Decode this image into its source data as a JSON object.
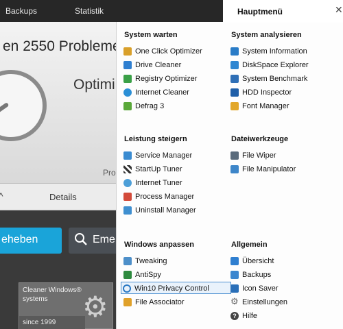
{
  "topbar": {
    "tab_backups": "Backups",
    "tab_statistik": "Statistik"
  },
  "background": {
    "problem_title": "en 2550 Probleme",
    "optimize_title": "Optimi",
    "pro_text": "Pro",
    "details_label": "Details",
    "fix_button_label": "eheben",
    "more_button_label": "Eme",
    "badge": {
      "line1": "Cleaner Windows®",
      "line2": "systems",
      "year": "since 1999"
    }
  },
  "menu": {
    "tab_label": "Hauptmenü",
    "sections": {
      "system_warten": {
        "title": "System warten",
        "items": [
          {
            "label": "One Click Optimizer",
            "icon": "one-click-optimizer-icon",
            "color": "#d9a02b"
          },
          {
            "label": "Drive Cleaner",
            "icon": "drive-cleaner-icon",
            "color": "#2f7fd0"
          },
          {
            "label": "Registry Optimizer",
            "icon": "registry-optimizer-icon",
            "color": "#3aa047"
          },
          {
            "label": "Internet Cleaner",
            "icon": "internet-cleaner-icon",
            "color": "#2b8fd6"
          },
          {
            "label": "Defrag 3",
            "icon": "defrag-icon",
            "color": "#5aa83a"
          }
        ]
      },
      "system_analysieren": {
        "title": "System analysieren",
        "items": [
          {
            "label": "System Information",
            "icon": "system-information-icon",
            "color": "#2a7cc7"
          },
          {
            "label": "DiskSpace Explorer",
            "icon": "diskspace-explorer-icon",
            "color": "#2e86d1"
          },
          {
            "label": "System Benchmark",
            "icon": "system-benchmark-icon",
            "color": "#2f6fb6"
          },
          {
            "label": "HDD Inspector",
            "icon": "hdd-inspector-icon",
            "color": "#1f5fa8"
          },
          {
            "label": "Font Manager",
            "icon": "font-manager-icon",
            "color": "#e2a72a"
          }
        ]
      },
      "leistung_steigern": {
        "title": "Leistung steigern",
        "items": [
          {
            "label": "Service Manager",
            "icon": "service-manager-icon",
            "color": "#3a8bd1"
          },
          {
            "label": "StartUp Tuner",
            "icon": "startup-tuner-icon",
            "color": "#333333"
          },
          {
            "label": "Internet Tuner",
            "icon": "internet-tuner-icon",
            "color": "#4d9fd8"
          },
          {
            "label": "Process Manager",
            "icon": "process-manager-icon",
            "color": "#d34a3a"
          },
          {
            "label": "Uninstall Manager",
            "icon": "uninstall-manager-icon",
            "color": "#3f8fd0"
          }
        ]
      },
      "dateiwerkzeuge": {
        "title": "Dateiwerkzeuge",
        "items": [
          {
            "label": "File Wiper",
            "icon": "file-wiper-icon",
            "color": "#5a6b7c"
          },
          {
            "label": "File Manipulator",
            "icon": "file-manipulator-icon",
            "color": "#3e86c9"
          }
        ]
      },
      "windows_anpassen": {
        "title": "Windows anpassen",
        "items": [
          {
            "label": "Tweaking",
            "icon": "tweaking-icon",
            "color": "#4d8fc9"
          },
          {
            "label": "AntiSpy",
            "icon": "antispy-icon",
            "color": "#2e8a3f"
          },
          {
            "label": "Win10 Privacy Control",
            "icon": "win10-privacy-icon",
            "color": "#2a79c4"
          },
          {
            "label": "File Associator",
            "icon": "file-associator-icon",
            "color": "#e0a12a"
          }
        ]
      },
      "allgemein": {
        "title": "Allgemein",
        "items": [
          {
            "label": "Übersicht",
            "icon": "overview-icon",
            "color": "#2f7fd0"
          },
          {
            "label": "Backups",
            "icon": "backups-icon",
            "color": "#3b86cf"
          },
          {
            "label": "Icon Saver",
            "icon": "icon-saver-icon",
            "color": "#2a6fb8"
          },
          {
            "label": "Einstellungen",
            "icon": "settings-icon",
            "color": "#666666"
          },
          {
            "label": "Hilfe",
            "icon": "help-icon",
            "color": "#444444"
          }
        ]
      }
    }
  }
}
